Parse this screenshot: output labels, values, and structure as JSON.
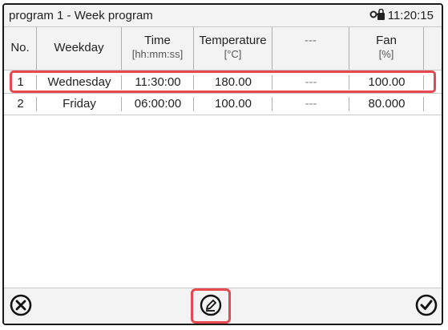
{
  "window": {
    "title": "program 1 - Week program",
    "time": "11:20:15"
  },
  "table": {
    "headers": [
      {
        "main": "No.",
        "unit": ""
      },
      {
        "main": "Weekday",
        "unit": ""
      },
      {
        "main": "Time",
        "unit": "[hh:mm:ss]"
      },
      {
        "main": "Temperature",
        "unit": "[°C]"
      },
      {
        "main": "---",
        "unit": ""
      },
      {
        "main": "Fan",
        "unit": "[%]"
      }
    ],
    "rows": [
      {
        "no": "1",
        "weekday": "Wednesday",
        "time": "11:30:00",
        "temperature": "180.00",
        "col5": "---",
        "fan": "100.00"
      },
      {
        "no": "2",
        "weekday": "Friday",
        "time": "06:00:00",
        "temperature": "100.00",
        "col5": "---",
        "fan": "80.000"
      }
    ]
  },
  "footer": {
    "cancel_icon": "close-circle-icon",
    "edit_icon": "pencil-circle-icon",
    "confirm_icon": "check-circle-icon"
  },
  "colors": {
    "highlight": "#e8474f",
    "header_bg": "#f3f3f3"
  }
}
